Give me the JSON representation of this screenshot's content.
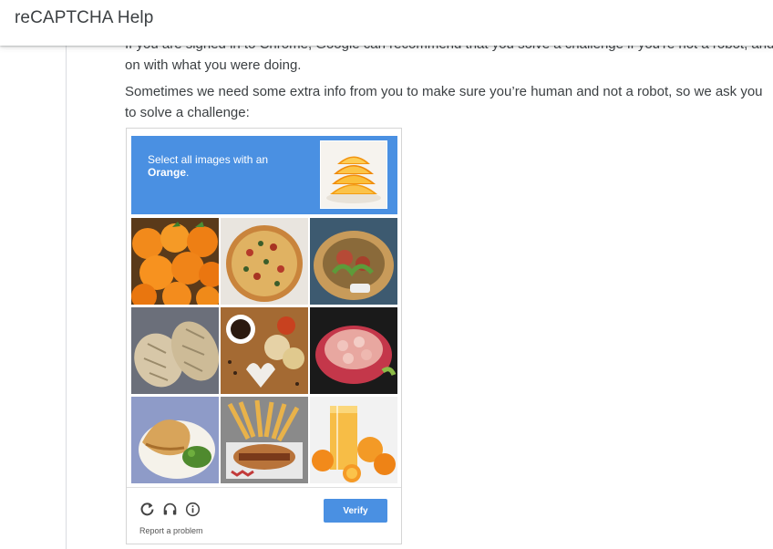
{
  "header": {
    "title": "reCAPTCHA Help"
  },
  "article": {
    "clipped_line": "If you are signed in to Chrome, Google can recommend that you solve a challenge if you're not a robot, and then let you carry",
    "para1_end": "on with what you were doing.",
    "para2": "Sometimes we need some extra info from you to make sure you’re human and not a robot, so we ask you to solve a challenge:"
  },
  "captcha": {
    "instruction_prefix": "Select all images with an",
    "target": "Orange",
    "target_suffix": ".",
    "sample_icon": "orange-slices-image",
    "tiles": [
      "oranges-image",
      "pizza-image",
      "salad-plate-image",
      "bread-loaves-image",
      "coffee-cookies-image",
      "shrimp-platter-image",
      "sandwich-plate-image",
      "fries-burger-image",
      "orange-juice-image"
    ],
    "verify_label": "Verify",
    "report_label": "Report a problem",
    "colors": {
      "header": "#4a90e2",
      "button": "#4a90e2"
    }
  }
}
